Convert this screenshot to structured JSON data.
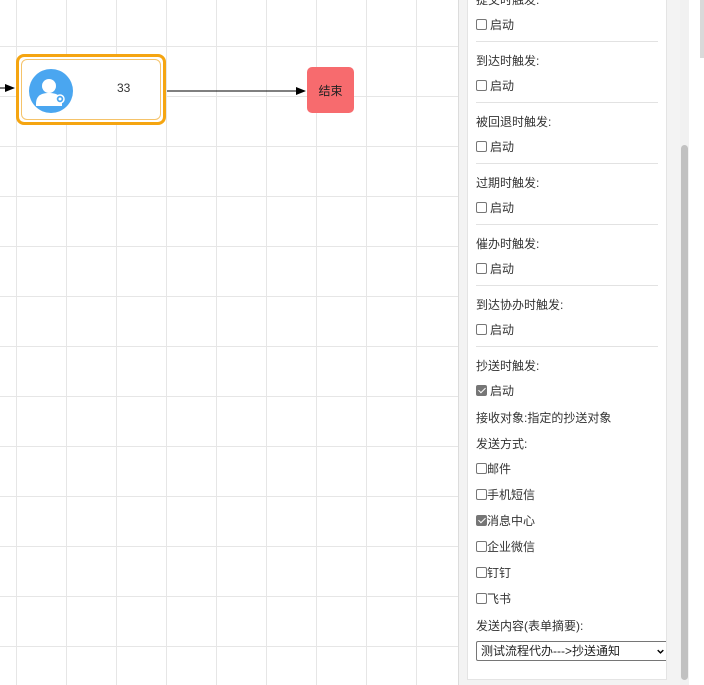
{
  "canvas": {
    "task_node_label": "33",
    "end_node_label": "结束",
    "colors": {
      "task_border": "#f5a511",
      "avatar": "#4aa6f0",
      "end_node": "#f76b6e"
    }
  },
  "panel": {
    "sections": [
      {
        "title": "提交时触发:",
        "checkbox_label": "启动",
        "checked": false
      },
      {
        "title": "到达时触发:",
        "checkbox_label": "启动",
        "checked": false
      },
      {
        "title": "被回退时触发:",
        "checkbox_label": "启动",
        "checked": false
      },
      {
        "title": "过期时触发:",
        "checkbox_label": "启动",
        "checked": false
      },
      {
        "title": "催办时触发:",
        "checkbox_label": "启动",
        "checked": false
      },
      {
        "title": "到达协办时触发:",
        "checkbox_label": "启动",
        "checked": false
      },
      {
        "title": "抄送时触发:",
        "checkbox_label": "启动",
        "checked": true
      }
    ],
    "receiver_text": "接收对象:指定的抄送对象",
    "send_method_label": "发送方式:",
    "send_methods": [
      {
        "label": "邮件",
        "checked": false
      },
      {
        "label": "手机短信",
        "checked": false
      },
      {
        "label": "消息中心",
        "checked": true
      },
      {
        "label": "企业微信",
        "checked": false
      },
      {
        "label": "钉钉",
        "checked": false
      },
      {
        "label": "飞书",
        "checked": false
      }
    ],
    "content_label": "发送内容(表单摘要):",
    "content_select_value": "测试流程代办--->抄送通知"
  }
}
